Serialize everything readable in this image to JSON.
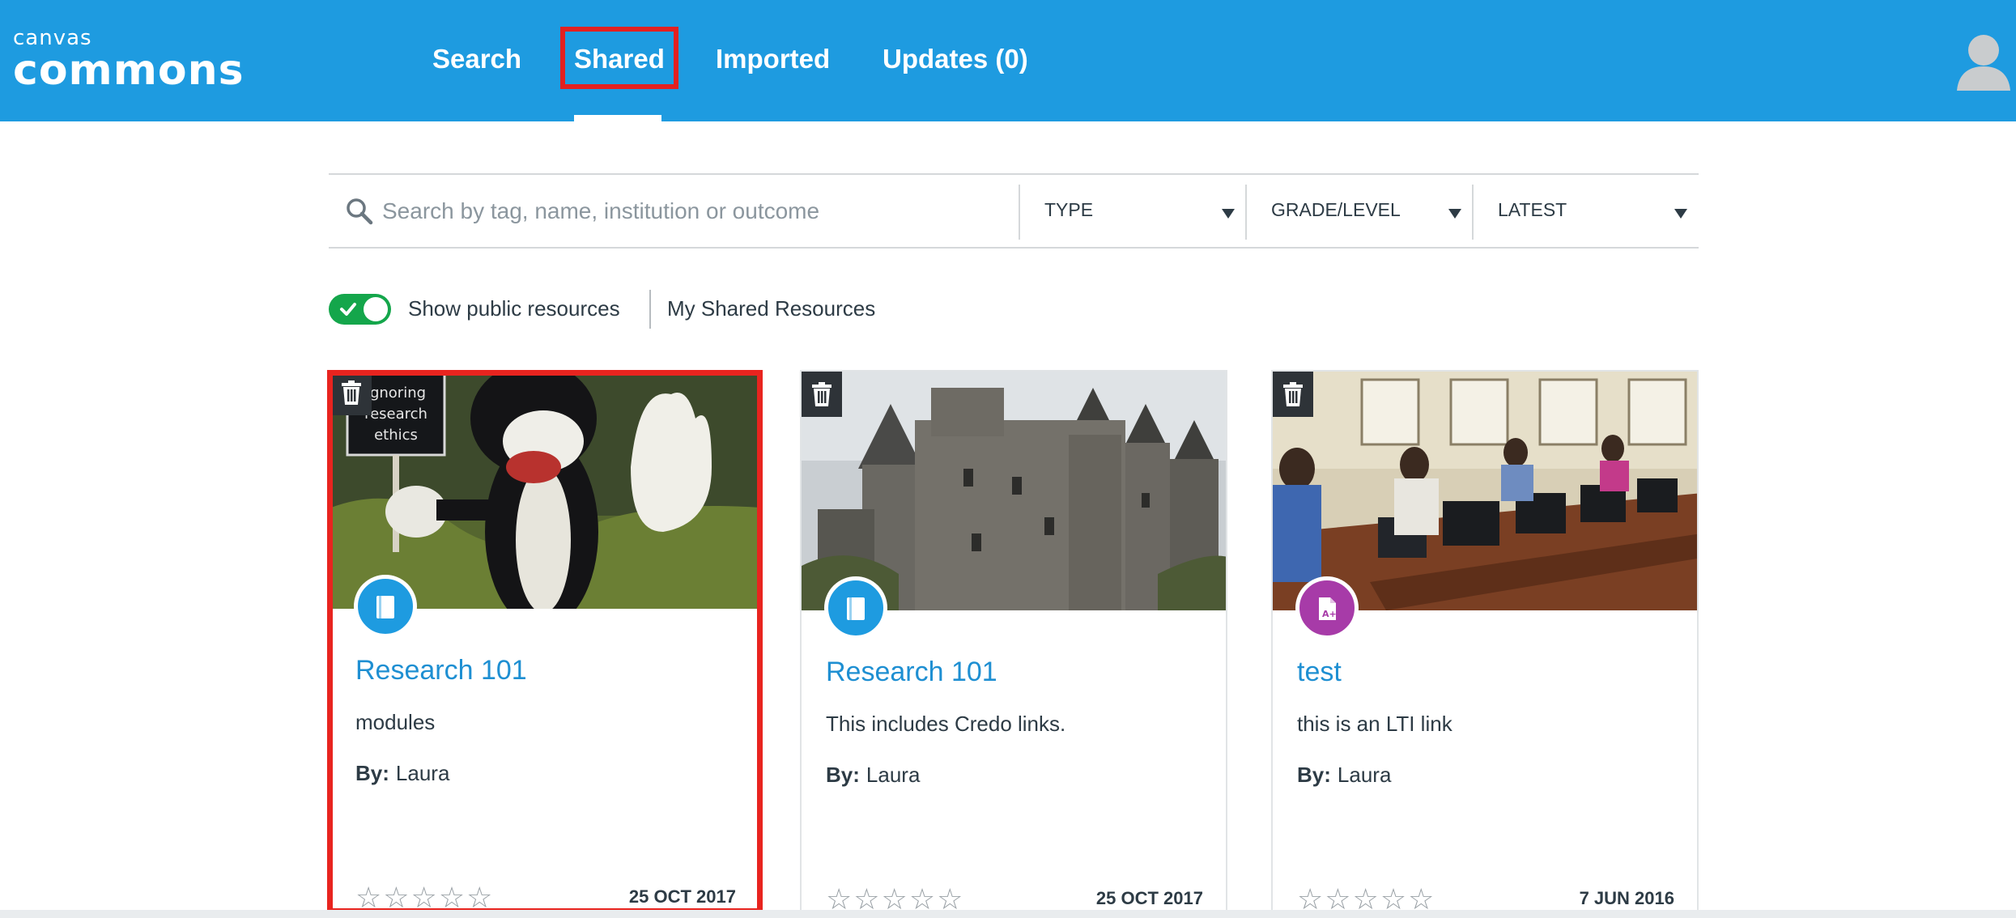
{
  "brand": {
    "logo_top": "canvas",
    "logo_main": "commons"
  },
  "nav": {
    "items": [
      {
        "label": "Search"
      },
      {
        "label": "Shared"
      },
      {
        "label": "Imported"
      },
      {
        "label": "Updates (0)"
      }
    ],
    "active": "Shared"
  },
  "search": {
    "placeholder": "Search by tag, name, institution or outcome",
    "value": ""
  },
  "filters": [
    {
      "label": "TYPE"
    },
    {
      "label": "GRADE/LEVEL"
    },
    {
      "label": "LATEST"
    }
  ],
  "toggles": {
    "show_public_label": "Show public resources",
    "show_public_on": true,
    "my_shared_label": "My Shared Resources"
  },
  "cards": [
    {
      "title": "Research 101",
      "description": "modules",
      "by_label": "By:",
      "author": "Laura",
      "rating": "☆☆☆☆☆",
      "date": "25 OCT 2017",
      "resource_type": "course",
      "image_text": [
        "ignoring",
        "research",
        "ethics"
      ]
    },
    {
      "title": "Research 101",
      "description": "This includes Credo links.",
      "by_label": "By:",
      "author": "Laura",
      "rating": "☆☆☆☆☆",
      "date": "25 OCT 2017",
      "resource_type": "course"
    },
    {
      "title": "test",
      "description": "this is an LTI link",
      "by_label": "By:",
      "author": "Laura",
      "rating": "☆☆☆☆☆",
      "date": "7 JUN 2016",
      "resource_type": "assignment"
    }
  ],
  "colors": {
    "header": "#1e9be0",
    "highlight": "#e8241f",
    "toggle_on": "#14a64b",
    "link": "#1e8fd2",
    "course_badge": "#1e9be0",
    "assignment_badge": "#a73ba8"
  },
  "icons": {
    "search": "magnifier-icon",
    "trash": "trash-icon",
    "course": "book-icon",
    "assignment": "document-grade-icon",
    "avatar": "user-silhouette-icon"
  }
}
